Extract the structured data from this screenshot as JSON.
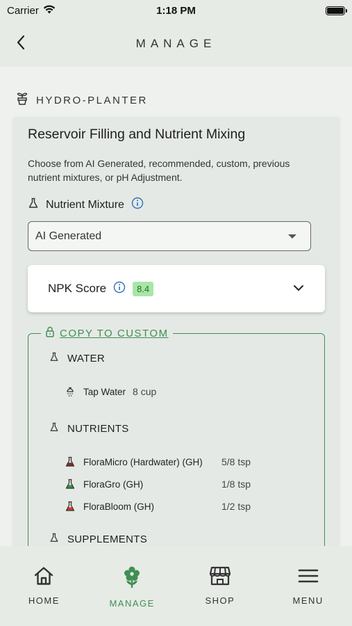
{
  "status_bar": {
    "carrier": "Carrier",
    "time": "1:18 PM"
  },
  "header": {
    "title": "MANAGE"
  },
  "device": {
    "name": "HYDRO-PLANTER"
  },
  "card": {
    "title": "Reservoir Filling and Nutrient Mixing",
    "description": "Choose from AI Generated, recommended, custom, previous nutrient mixtures, or pH Adjustment.",
    "nutrient_mixture_label": "Nutrient Mixture",
    "dropdown_value": "AI Generated",
    "npk_label": "NPK Score",
    "npk_value": "8.4",
    "copy_label": "COPY TO CUSTOM"
  },
  "recipe": {
    "water": {
      "title": "WATER",
      "items": [
        {
          "name": "Tap Water",
          "qty": "8 cup"
        }
      ]
    },
    "nutrients": {
      "title": "NUTRIENTS",
      "items": [
        {
          "name": "FloraMicro (Hardwater) (GH)",
          "qty": "5/8 tsp",
          "color": "#8b2a22"
        },
        {
          "name": "FloraGro (GH)",
          "qty": "1/8 tsp",
          "color": "#2e9a3e"
        },
        {
          "name": "FloraBloom (GH)",
          "qty": "1/2 tsp",
          "color": "#d03a2e"
        }
      ]
    },
    "supplements": {
      "title": "SUPPLEMENTS"
    }
  },
  "tabs": [
    {
      "label": "HOME",
      "icon": "home-icon"
    },
    {
      "label": "MANAGE",
      "icon": "plant-icon"
    },
    {
      "label": "SHOP",
      "icon": "shop-icon"
    },
    {
      "label": "MENU",
      "icon": "menu-icon"
    }
  ],
  "colors": {
    "accent": "#3f8f52",
    "background": "#e6ebe6"
  }
}
